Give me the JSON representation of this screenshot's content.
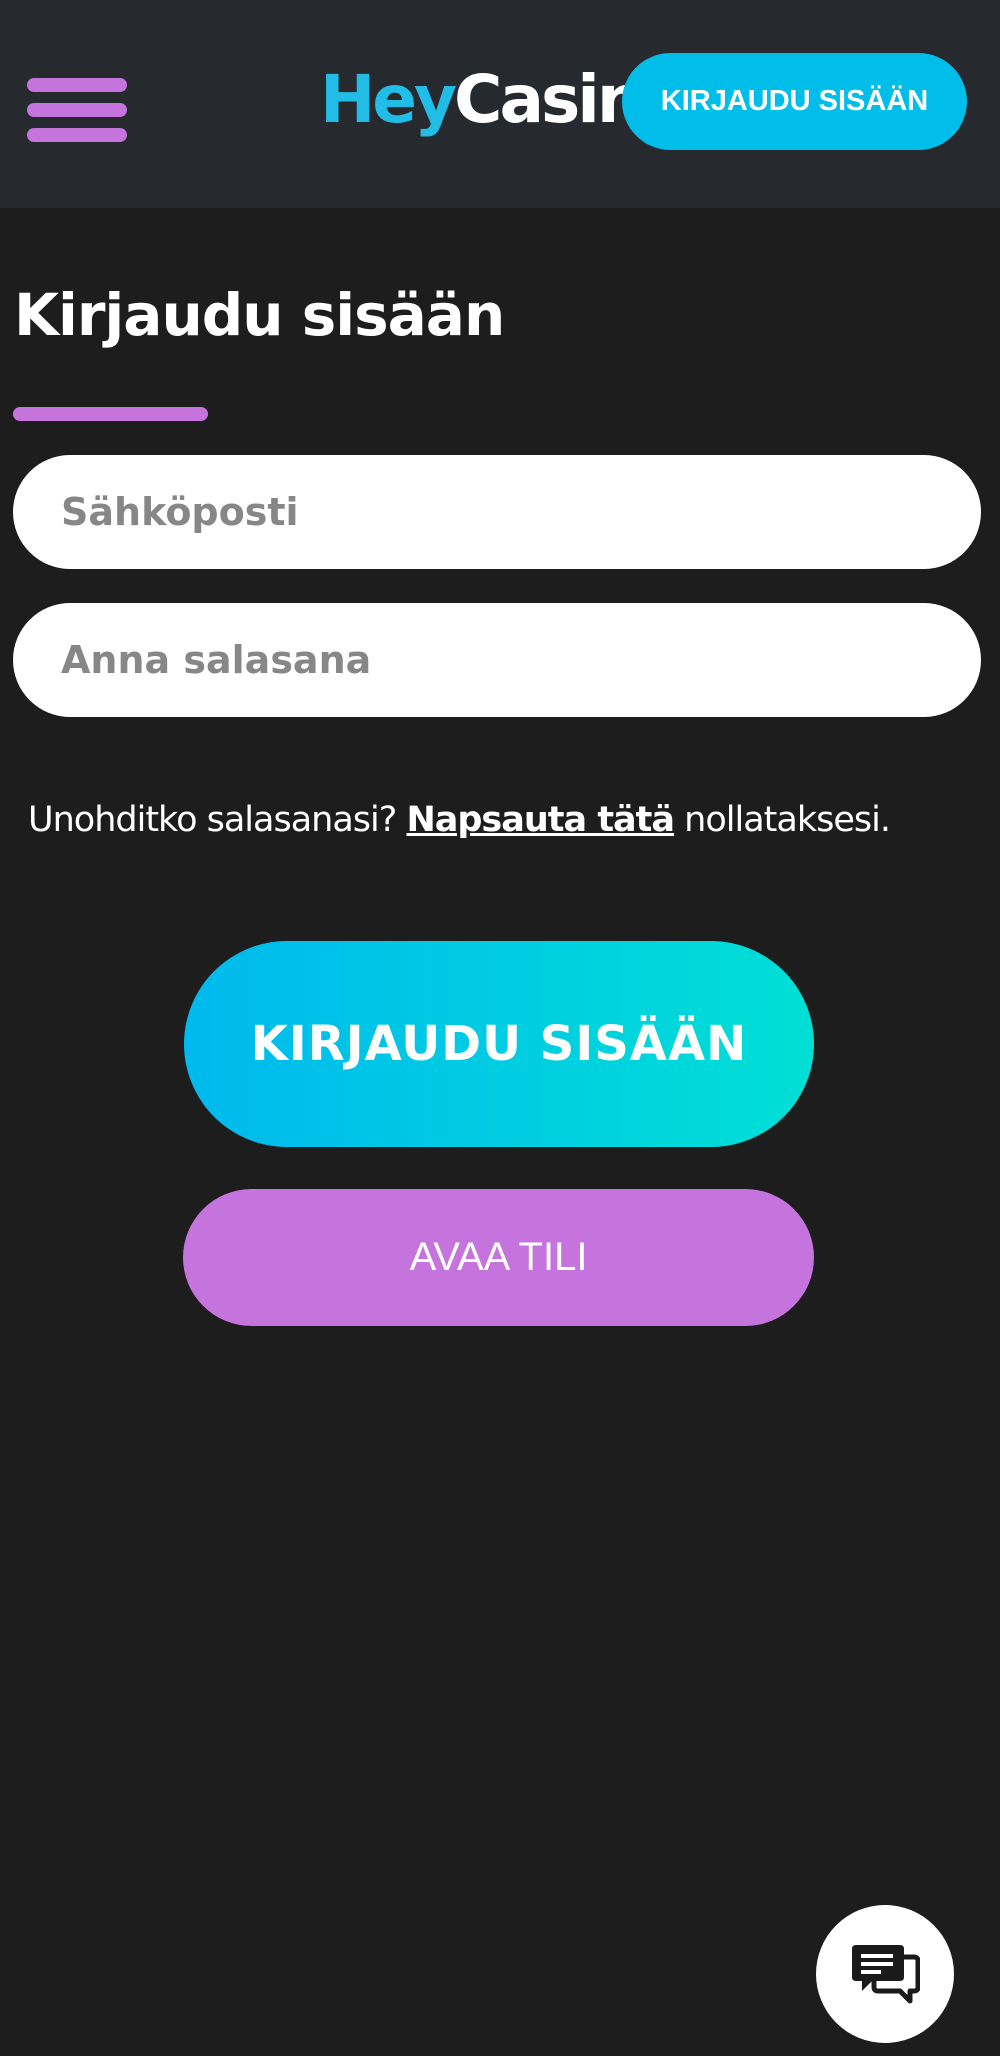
{
  "header": {
    "logo_part1": "Hey",
    "logo_part2": "Casino",
    "login_label": "KIRJAUDU SISÄÄN"
  },
  "form": {
    "title": "Kirjaudu sisään",
    "email_placeholder": "Sähköposti",
    "password_placeholder": "Anna salasana",
    "forgot_prefix": "Unohditko salasanasi? ",
    "forgot_link": "Napsauta tätä",
    "forgot_suffix": " nollataksesi.",
    "login_label": "KIRJAUDU SISÄÄN",
    "register_label": "AVAA TILI"
  },
  "icons": {
    "menu": "hamburger-menu-icon",
    "chat": "chat-icon"
  },
  "colors": {
    "background": "#1d1d1d",
    "header_background": "#262a2e",
    "accent_cyan": "#00bdea",
    "accent_purple": "#c474dc",
    "gradient_start": "#00b9ef",
    "gradient_end": "#00dfd5"
  }
}
